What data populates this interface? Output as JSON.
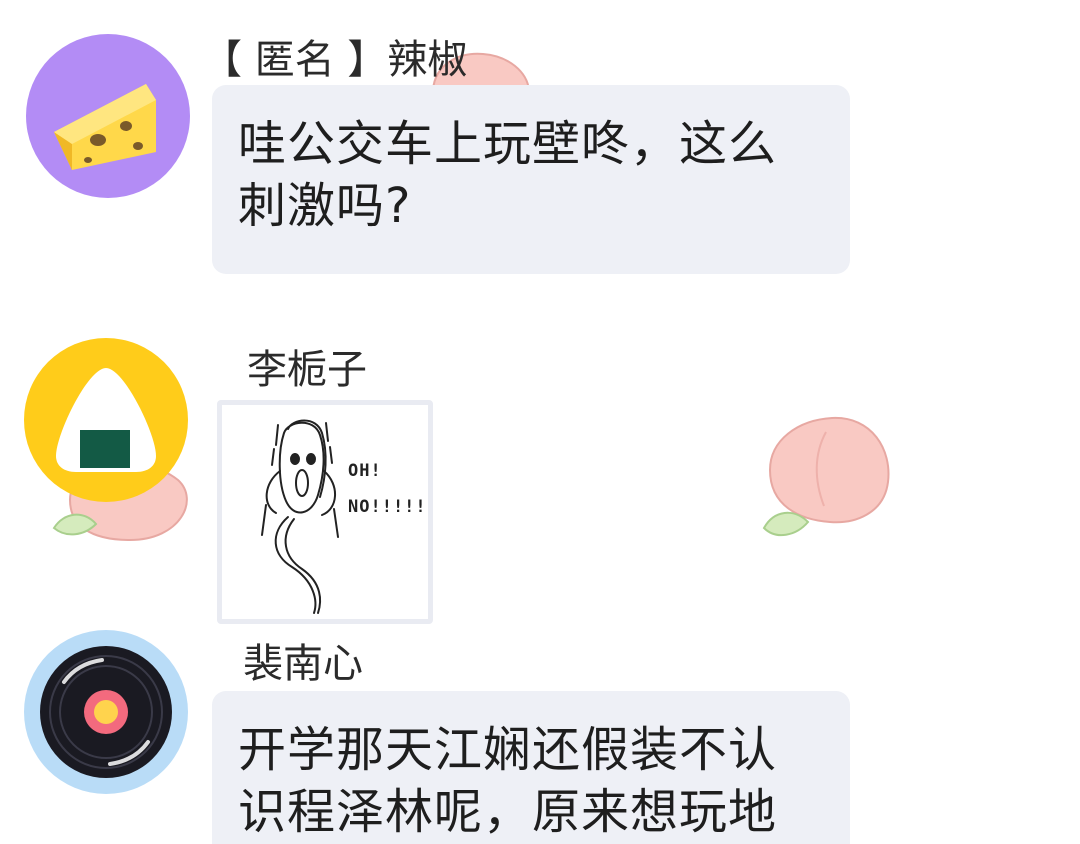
{
  "messages": [
    {
      "sender": "【 匿名 】辣椒",
      "avatar_icon": "cheese-icon",
      "avatar_bg": "#b38cf5",
      "lines": [
        "哇公交车上玩壁咚，这么",
        "刺激吗?"
      ]
    },
    {
      "sender": "李栀子",
      "avatar_icon": "onigiri-icon",
      "avatar_bg": "#ffcc1a",
      "sticker": {
        "icon": "ghost-scream-icon",
        "text_line1": "OH!",
        "text_line2": "NO!!!!!"
      }
    },
    {
      "sender": "裴南心",
      "avatar_icon": "vinyl-record-icon",
      "avatar_bg": "#b9dcf7",
      "lines": [
        "开学那天江娴还假装不认",
        "识程泽林呢，原来想玩地"
      ]
    }
  ],
  "colors": {
    "bubble": "#eef0f6",
    "peach": "#f9c4c0",
    "leaf": "#cde8b2"
  }
}
